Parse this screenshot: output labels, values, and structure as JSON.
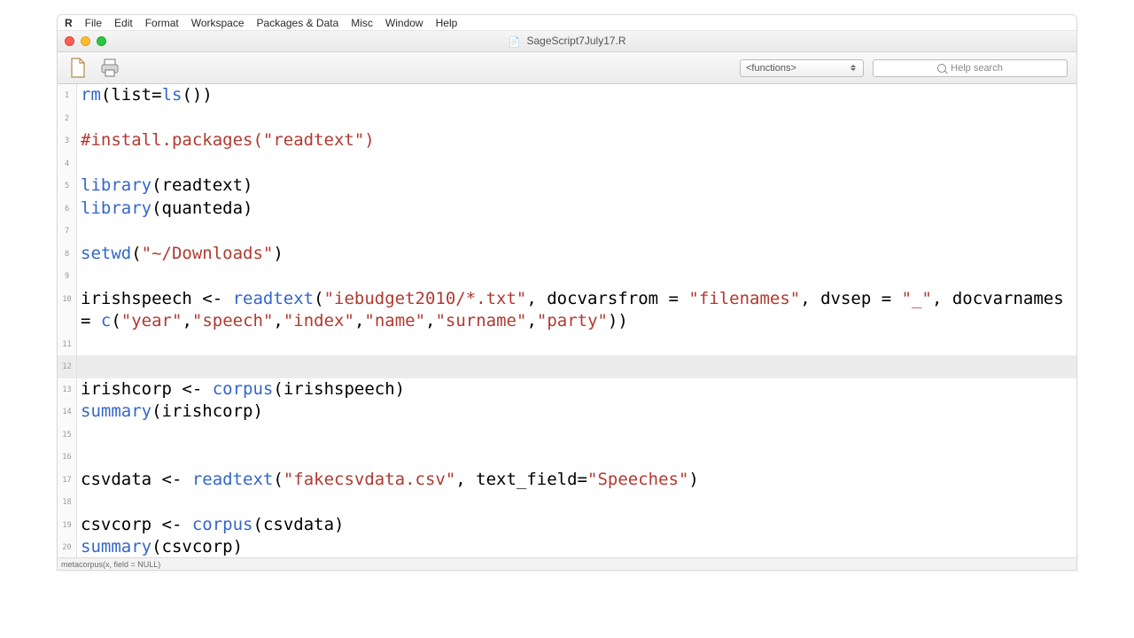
{
  "menubar": {
    "logo": "R",
    "items": [
      "File",
      "Edit",
      "Format",
      "Workspace",
      "Packages & Data",
      "Misc",
      "Window",
      "Help"
    ]
  },
  "window": {
    "title": "SageScript7July17.R"
  },
  "toolbar": {
    "functions_label": "<functions>",
    "help_placeholder": "Help search"
  },
  "code_lines": [
    {
      "n": 1,
      "tokens": [
        [
          "kw",
          "rm"
        ],
        [
          "paren",
          "("
        ],
        [
          "call",
          "list"
        ],
        [
          "op",
          "="
        ],
        [
          "kw",
          "ls"
        ],
        [
          "paren",
          "())"
        ]
      ]
    },
    {
      "n": 2,
      "tokens": []
    },
    {
      "n": 3,
      "tokens": [
        [
          "cmt",
          "#install.packages(\"readtext\")"
        ]
      ]
    },
    {
      "n": 4,
      "tokens": []
    },
    {
      "n": 5,
      "tokens": [
        [
          "kw",
          "library"
        ],
        [
          "paren",
          "("
        ],
        [
          "call",
          "readtext"
        ],
        [
          "paren",
          ")"
        ]
      ]
    },
    {
      "n": 6,
      "tokens": [
        [
          "kw",
          "library"
        ],
        [
          "paren",
          "("
        ],
        [
          "call",
          "quanteda"
        ],
        [
          "paren",
          ")"
        ]
      ]
    },
    {
      "n": 7,
      "tokens": []
    },
    {
      "n": 8,
      "tokens": [
        [
          "kw",
          "setwd"
        ],
        [
          "paren",
          "("
        ],
        [
          "str",
          "\"~/Downloads\""
        ],
        [
          "paren",
          ")"
        ]
      ]
    },
    {
      "n": 9,
      "tokens": []
    },
    {
      "n": 10,
      "tokens": [
        [
          "call",
          "irishspeech "
        ],
        [
          "op",
          "<- "
        ],
        [
          "kw",
          "readtext"
        ],
        [
          "paren",
          "("
        ],
        [
          "str",
          "\"iebudget2010/*.txt\""
        ],
        [
          "call",
          ", docvarsfrom = "
        ],
        [
          "str",
          "\"filenames\""
        ],
        [
          "call",
          ", dvsep = "
        ],
        [
          "str",
          "\"_\""
        ],
        [
          "call",
          ", docvarnames = "
        ],
        [
          "kw",
          "c"
        ],
        [
          "paren",
          "("
        ],
        [
          "str",
          "\"year\""
        ],
        [
          "call",
          ","
        ],
        [
          "str",
          "\"speech\""
        ],
        [
          "call",
          ","
        ],
        [
          "str",
          "\"index\""
        ],
        [
          "call",
          ","
        ],
        [
          "str",
          "\"name\""
        ],
        [
          "call",
          ","
        ],
        [
          "str",
          "\"surname\""
        ],
        [
          "call",
          ","
        ],
        [
          "str",
          "\"party\""
        ],
        [
          "paren",
          "))"
        ]
      ]
    },
    {
      "n": 11,
      "tokens": []
    },
    {
      "n": 12,
      "tokens": [],
      "highlight": true
    },
    {
      "n": 13,
      "tokens": [
        [
          "call",
          "irishcorp "
        ],
        [
          "op",
          "<- "
        ],
        [
          "kw",
          "corpus"
        ],
        [
          "paren",
          "("
        ],
        [
          "call",
          "irishspeech"
        ],
        [
          "paren",
          ")"
        ]
      ]
    },
    {
      "n": 14,
      "tokens": [
        [
          "kw",
          "summary"
        ],
        [
          "paren",
          "("
        ],
        [
          "call",
          "irishcorp"
        ],
        [
          "paren",
          ")"
        ]
      ]
    },
    {
      "n": 15,
      "tokens": []
    },
    {
      "n": 16,
      "tokens": []
    },
    {
      "n": 17,
      "tokens": [
        [
          "call",
          "csvdata "
        ],
        [
          "op",
          "<- "
        ],
        [
          "kw",
          "readtext"
        ],
        [
          "paren",
          "("
        ],
        [
          "str",
          "\"fakecsvdata.csv\""
        ],
        [
          "call",
          ", text_field="
        ],
        [
          "str",
          "\"Speeches\""
        ],
        [
          "paren",
          ")"
        ]
      ]
    },
    {
      "n": 18,
      "tokens": []
    },
    {
      "n": 19,
      "tokens": [
        [
          "call",
          "csvcorp "
        ],
        [
          "op",
          "<- "
        ],
        [
          "kw",
          "corpus"
        ],
        [
          "paren",
          "("
        ],
        [
          "call",
          "csvdata"
        ],
        [
          "paren",
          ")"
        ]
      ]
    },
    {
      "n": 20,
      "tokens": [
        [
          "kw",
          "summary"
        ],
        [
          "paren",
          "("
        ],
        [
          "call",
          "csvcorp"
        ],
        [
          "paren",
          ")"
        ]
      ]
    }
  ],
  "statusbar": {
    "text": "metacorpus(x, field = NULL)"
  }
}
